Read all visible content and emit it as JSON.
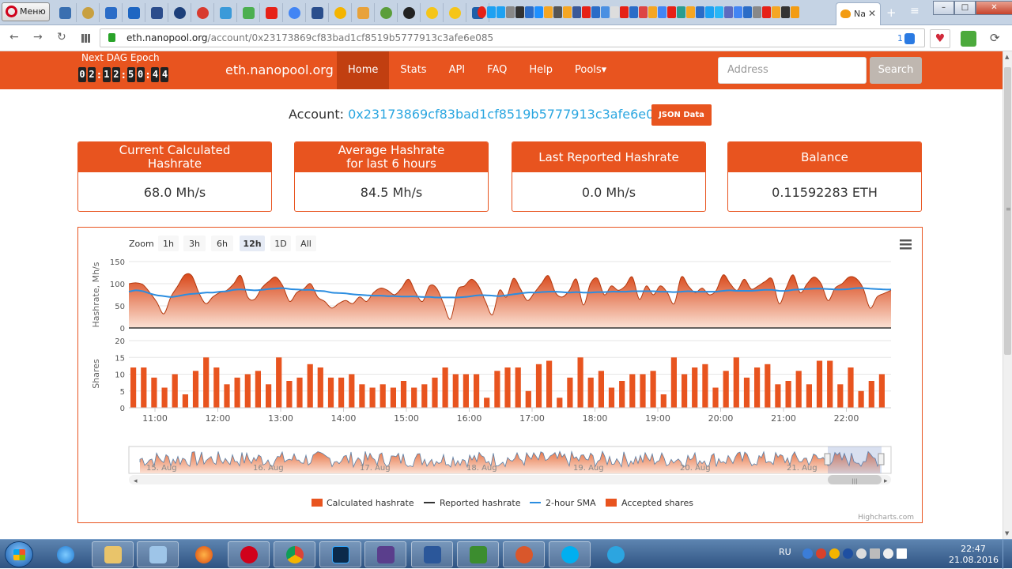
{
  "browser": {
    "menu_label": "Меню",
    "active_tab_label": "Na",
    "url_host": "eth.nanopool.org",
    "url_path": "/account/0x23173869cf83bad1cf8519b5777913c3afe6e085",
    "url_badge_count": "1"
  },
  "nav": {
    "dag_label": "Next DAG Epoch",
    "dag_digits": [
      "0",
      "2",
      ":",
      "1",
      "2",
      ":",
      "5",
      "0",
      ":",
      "4",
      "4"
    ],
    "brand": "eth.nanopool.org",
    "items": [
      "Home",
      "Stats",
      "API",
      "FAQ",
      "Help",
      "Pools▾"
    ],
    "active_item": "Home",
    "search_placeholder": "Address",
    "search_button": "Search"
  },
  "account": {
    "label": "Account:",
    "address": "0x23173869cf83bad1cf8519b5777913c3afe6e085",
    "json_button": "JSON Data"
  },
  "stats": [
    {
      "title": "Current Calculated Hashrate",
      "value": "68.0 Mh/s"
    },
    {
      "title": "Average Hashrate for last 6 hours",
      "value": "84.5 Mh/s"
    },
    {
      "title": "Last Reported Hashrate",
      "value": "0.0 Mh/s"
    },
    {
      "title": "Balance",
      "value": "0.11592283 ETH"
    }
  ],
  "chart_data": {
    "type": "area",
    "zoom_label": "Zoom",
    "zoom_options": [
      "1h",
      "3h",
      "6h",
      "12h",
      "1D",
      "All"
    ],
    "zoom_selected": "12h",
    "credit": "Highcharts.com",
    "x_ticks": [
      "11:00",
      "12:00",
      "13:00",
      "14:00",
      "15:00",
      "16:00",
      "17:00",
      "18:00",
      "19:00",
      "20:00",
      "21:00",
      "22:00"
    ],
    "hashrate_axis": {
      "label": "Hashrate, Mh/s",
      "ylim": [
        0,
        150
      ],
      "ticks": [
        0,
        50,
        100,
        150
      ]
    },
    "shares_axis": {
      "label": "Shares",
      "ylim": [
        0,
        20
      ],
      "ticks": [
        0,
        5,
        10,
        15,
        20
      ]
    },
    "navigator_labels": [
      "15. Aug",
      "16. Aug",
      "17. Aug",
      "18. Aug",
      "19. Aug",
      "20. Aug",
      "21. Aug"
    ],
    "legend": [
      "Calculated hashrate",
      "Reported hashrate",
      "2-hour SMA",
      "Accepted shares"
    ],
    "colors": {
      "calculated": "#e8541f",
      "reported": "#333333",
      "sma": "#2b8de0",
      "shares": "#e8541f"
    },
    "calculated_hashrate": [
      100,
      102,
      98,
      80,
      58,
      32,
      70,
      95,
      120,
      118,
      80,
      55,
      70,
      80,
      85,
      100,
      118,
      70,
      65,
      90,
      105,
      115,
      95,
      60,
      80,
      88,
      100,
      70,
      60,
      45,
      55,
      62,
      55,
      70,
      60,
      80,
      90,
      85,
      75,
      90,
      110,
      80,
      60,
      95,
      90,
      55,
      20,
      85,
      95,
      110,
      95,
      60,
      30,
      85,
      70,
      112,
      88,
      62,
      80,
      100,
      118,
      80,
      70,
      85,
      110,
      52,
      100,
      112,
      75,
      95,
      85,
      95,
      115,
      65,
      95,
      75,
      95,
      80,
      55,
      115,
      95,
      80,
      90,
      75,
      85,
      120,
      100,
      85,
      110,
      88,
      95,
      105,
      110,
      55,
      90,
      120,
      80,
      100,
      115,
      100,
      62,
      90,
      100,
      115,
      112,
      90,
      45,
      70,
      78,
      85
    ],
    "sma_2h": [
      82,
      85,
      83,
      78,
      74,
      72,
      70,
      72,
      75,
      77,
      78,
      80,
      80,
      82,
      83,
      86,
      87,
      86,
      85,
      86,
      88,
      89,
      90,
      88,
      87,
      86,
      86,
      84,
      83,
      80,
      79,
      78,
      76,
      75,
      74,
      73,
      73,
      72,
      72,
      71,
      71,
      71,
      70,
      70,
      69,
      69,
      69,
      69,
      70,
      72,
      74,
      74,
      73,
      72,
      74,
      76,
      78,
      80,
      80,
      81,
      82,
      82,
      81,
      80,
      81,
      80,
      80,
      81,
      81,
      82,
      82,
      82,
      83,
      83,
      83,
      83,
      82,
      82,
      81,
      82,
      83,
      82,
      82,
      82,
      82,
      84,
      85,
      84,
      84,
      84,
      85,
      86,
      86,
      84,
      84,
      86,
      87,
      88,
      89,
      89,
      88,
      87,
      87,
      88,
      90,
      90,
      89,
      88,
      87,
      87
    ],
    "shares": [
      12,
      12,
      9,
      6,
      10,
      4,
      11,
      15,
      12,
      7,
      9,
      10,
      11,
      7,
      15,
      8,
      9,
      13,
      12,
      9,
      9,
      10,
      7,
      6,
      7,
      6,
      8,
      6,
      7,
      9,
      12,
      10,
      10,
      10,
      3,
      11,
      12,
      12,
      5,
      13,
      14,
      3,
      9,
      15,
      9,
      11,
      6,
      8,
      10,
      10,
      11,
      4,
      15,
      10,
      12,
      13,
      6,
      11,
      15,
      9,
      12,
      13,
      7,
      8,
      11,
      7,
      14,
      14,
      7,
      12,
      5,
      8,
      10
    ]
  },
  "taskbar": {
    "lang": "RU",
    "time": "22:47",
    "date": "21.08.2016"
  }
}
